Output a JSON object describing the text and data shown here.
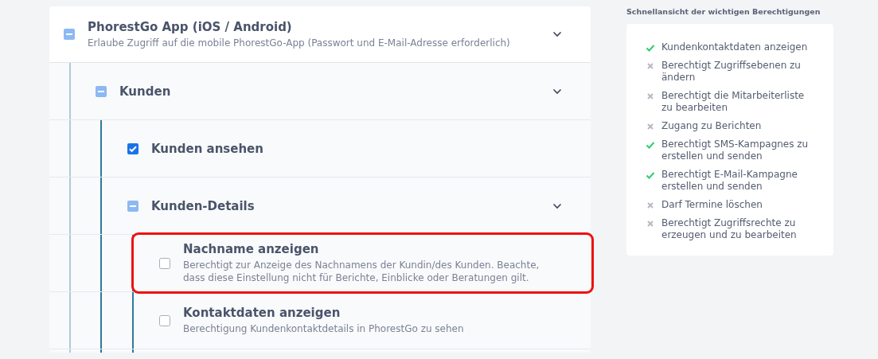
{
  "permissions": [
    {
      "title": "PhorestGo App (iOS / Android)",
      "description": "Erlaube Zugriff auf die mobile PhorestGo-App (Passwort und E-Mail-Adresse erforderlich)",
      "checked": false,
      "indeterminate": true,
      "expandable": true,
      "highlighted": false,
      "children": [
        {
          "title": "Kunden",
          "checked": false,
          "indeterminate": true,
          "expandable": true,
          "highlighted": false,
          "children": [
            {
              "title": "Kunden ansehen",
              "checked": true,
              "indeterminate": false,
              "expandable": false,
              "highlighted": false
            },
            {
              "title": "Kunden-Details",
              "checked": false,
              "indeterminate": true,
              "expandable": true,
              "highlighted": false,
              "children": [
                {
                  "title": "Nachname anzeigen",
                  "description": "Berechtigt zur Anzeige des Nachnamens der Kundin/des Kunden. Beachte, dass diese Einstellung nicht für Berichte, Einblicke oder Beratungen gilt.",
                  "checked": false,
                  "indeterminate": false,
                  "expandable": false,
                  "highlighted": true
                },
                {
                  "title": "Kontaktdaten anzeigen",
                  "description": "Berechtigung Kundenkontaktdetails in PhorestGo zu sehen",
                  "checked": false,
                  "indeterminate": false,
                  "expandable": false,
                  "highlighted": false
                }
              ]
            }
          ]
        }
      ]
    }
  ],
  "summary": {
    "heading": "Schnellansicht der wichtigen Berechtigungen",
    "items": [
      {
        "label": "Kundenkontaktdaten anzeigen",
        "allowed": true
      },
      {
        "label": "Berechtigt Zugriffsebenen zu ändern",
        "allowed": false
      },
      {
        "label": "Berechtigt die Mitarbeiterliste zu bearbeiten",
        "allowed": false
      },
      {
        "label": "Zugang zu Berichten",
        "allowed": false
      },
      {
        "label": "Berechtigt SMS-Kampagnes zu erstellen und senden",
        "allowed": true
      },
      {
        "label": "Berechtigt E-Mail-Kampagne erstellen und senden",
        "allowed": true
      },
      {
        "label": "Darf Termine löschen",
        "allowed": false
      },
      {
        "label": "Berechtigt Zugriffsrechte zu erzeugen und zu bearbeiten",
        "allowed": false
      }
    ]
  }
}
